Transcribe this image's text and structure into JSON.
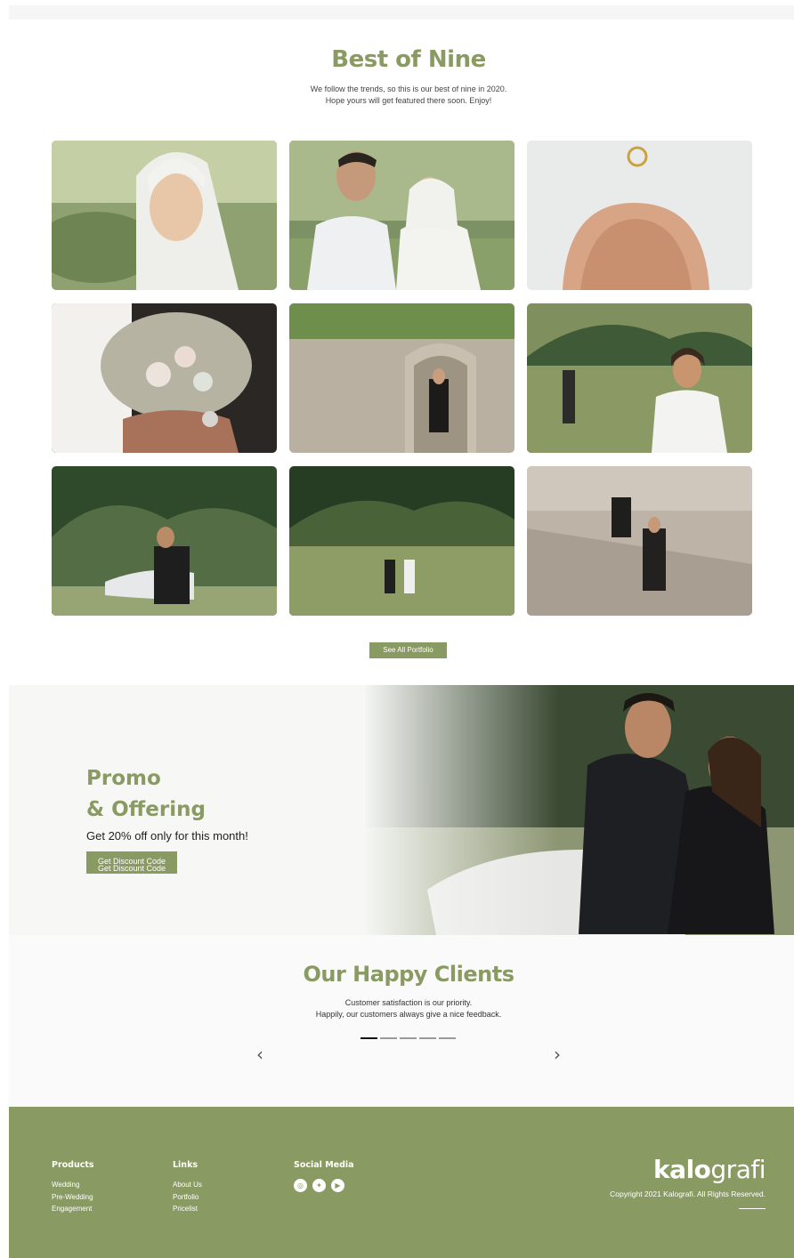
{
  "best_of_nine": {
    "title": "Best of Nine",
    "subtitle_line1": "We follow the trends, so this is our best of nine in 2020.",
    "subtitle_line2": "Hope yours will get featured there soon. Enjoy!",
    "see_all_label": "See All Portfolio"
  },
  "promo": {
    "title_line1": "Promo",
    "title_line2": "& Offering",
    "text": "Get 20% off only for this month!",
    "button_line1": "Get Discount Code",
    "button_line2": "Get Discount Code"
  },
  "clients": {
    "title": "Our Happy Clients",
    "subtitle_line1": "Customer satisfaction is our priority.",
    "subtitle_line2": "Happily, our customers always give a nice feedback.",
    "prev_icon": "‹",
    "next_icon": "›",
    "active_slide": 1,
    "slide_count": 5
  },
  "footer": {
    "products_heading": "Products",
    "products": [
      "Wedding",
      "Pre-Wedding",
      "Engagement"
    ],
    "links_heading": "Links",
    "links": [
      "About Us",
      "Portfolio",
      "Pricelist"
    ],
    "social_heading": "Social Media",
    "social_icons": [
      "instagram-icon",
      "twitter-icon",
      "youtube-icon"
    ],
    "social_glyphs": [
      "◎",
      "✦",
      "▶"
    ],
    "brand_bold": "kalo",
    "brand_light": "grafi",
    "copyright": "Copyright 2021 Kalografi. All Rights Reserved."
  },
  "colors": {
    "accent": "#8a9a63",
    "footer_bg": "#8a9a63",
    "clients_bg": "#fafafa"
  }
}
